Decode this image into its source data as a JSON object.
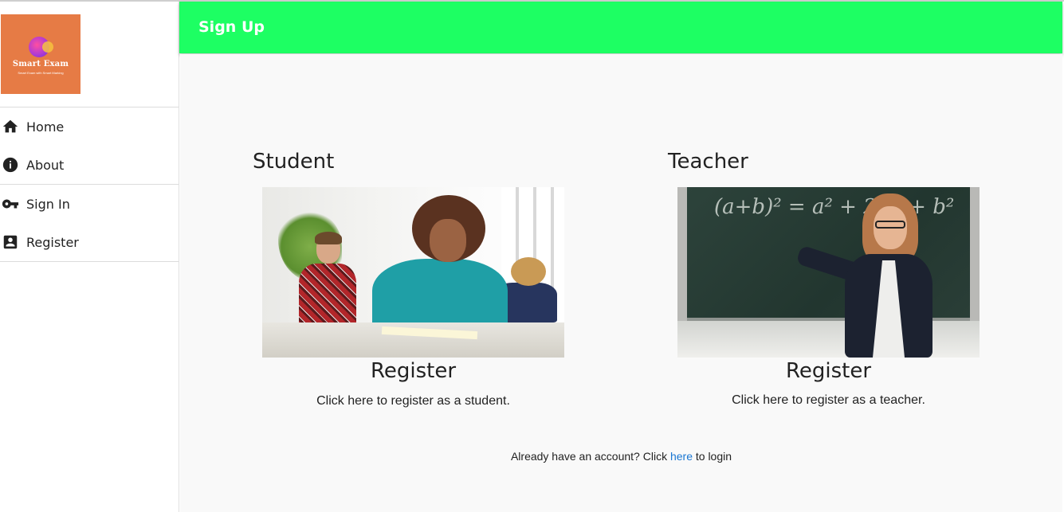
{
  "app": {
    "logo": {
      "brand": "Smart Exam",
      "tagline": "Smart Exam with Smart Marking"
    }
  },
  "sidebar": {
    "items": [
      {
        "label": "Home",
        "icon": "home-icon"
      },
      {
        "label": "About",
        "icon": "info-icon"
      },
      {
        "label": "Sign In",
        "icon": "key-icon"
      },
      {
        "label": "Register",
        "icon": "account-box-icon"
      }
    ]
  },
  "header": {
    "title": "Sign Up",
    "color": "#1dff63"
  },
  "cards": [
    {
      "title": "Student",
      "register": "Register",
      "description": "Click here to register as a student."
    },
    {
      "title": "Teacher",
      "register": "Register",
      "description": "Click here to register as a teacher.",
      "board_formula": "(a+b)² = a² + 2ab + b²"
    }
  ],
  "footer": {
    "prefix": "Already have an account? Click",
    "link": "here",
    "suffix": "to login",
    "link_color": "#1976d2"
  }
}
